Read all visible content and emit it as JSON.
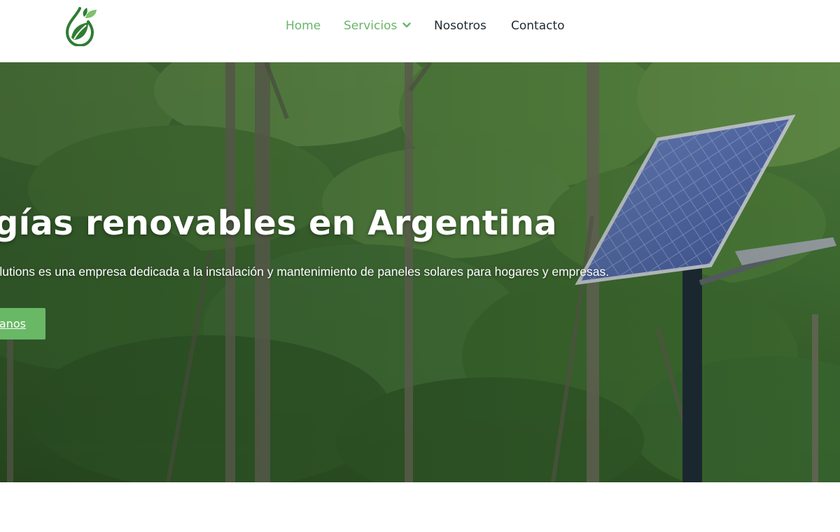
{
  "header": {
    "logo_icon": "leaf-drop-icon",
    "nav": [
      {
        "label": "Home",
        "active": true
      },
      {
        "label": "Servicios",
        "active": true,
        "dropdown_icon": "chevron-down-icon"
      },
      {
        "label": "Nosotros",
        "active": false
      },
      {
        "label": "Contacto",
        "active": false
      }
    ]
  },
  "hero": {
    "background": "forest-with-solar-panel-streetlight",
    "title": "rgías renovables en Argentina",
    "text": "Solutions es una empresa dedicada a la instalación y mantenimiento de paneles solares para hogares y empresas.",
    "button_label": "anos"
  },
  "colors": {
    "accent": "#6ab56a",
    "nav_text": "#1f2a33",
    "button": "#69b866",
    "logo_dark": "#2e7d32",
    "logo_light": "#7cc36a"
  }
}
